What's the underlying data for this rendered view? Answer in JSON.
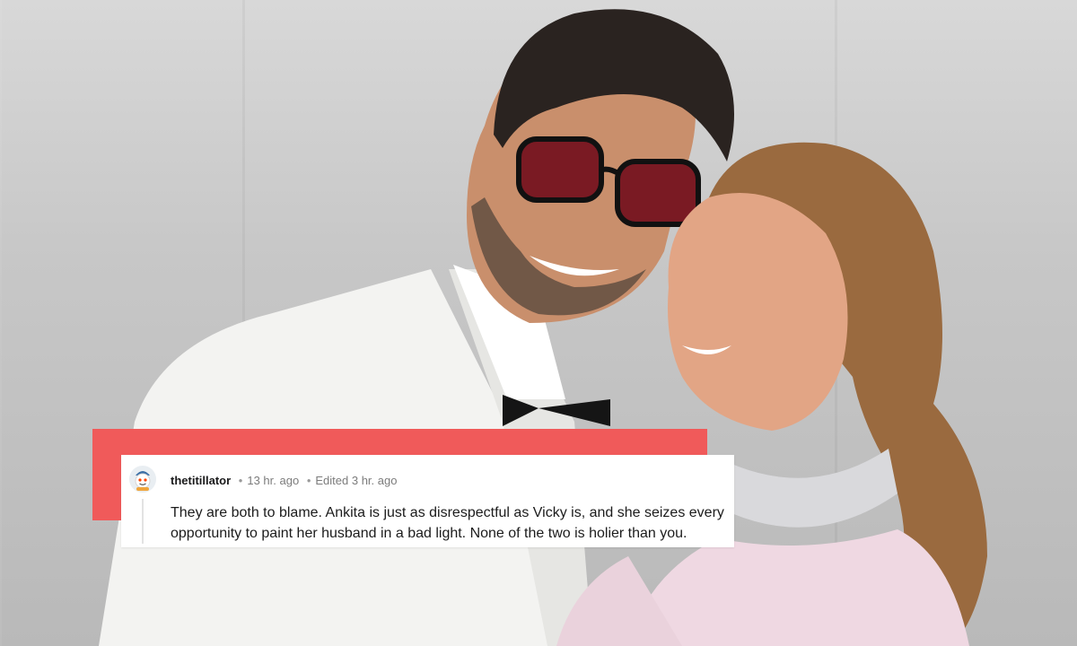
{
  "comment": {
    "username": "thetitillator",
    "time": "13 hr. ago",
    "edited": "Edited 3 hr. ago",
    "separator": "•",
    "body": "They are both to blame. Ankita is just as disrespectful as Vicky is, and she seizes every opportunity to paint her husband in a bad light. None of the two is holier than you."
  },
  "colors": {
    "accent": "#f05a5a",
    "card": "#ffffff",
    "username": "#1a1a1b",
    "meta": "#7c7c7c"
  },
  "icons": {
    "avatar": "snoo-avatar-icon"
  }
}
